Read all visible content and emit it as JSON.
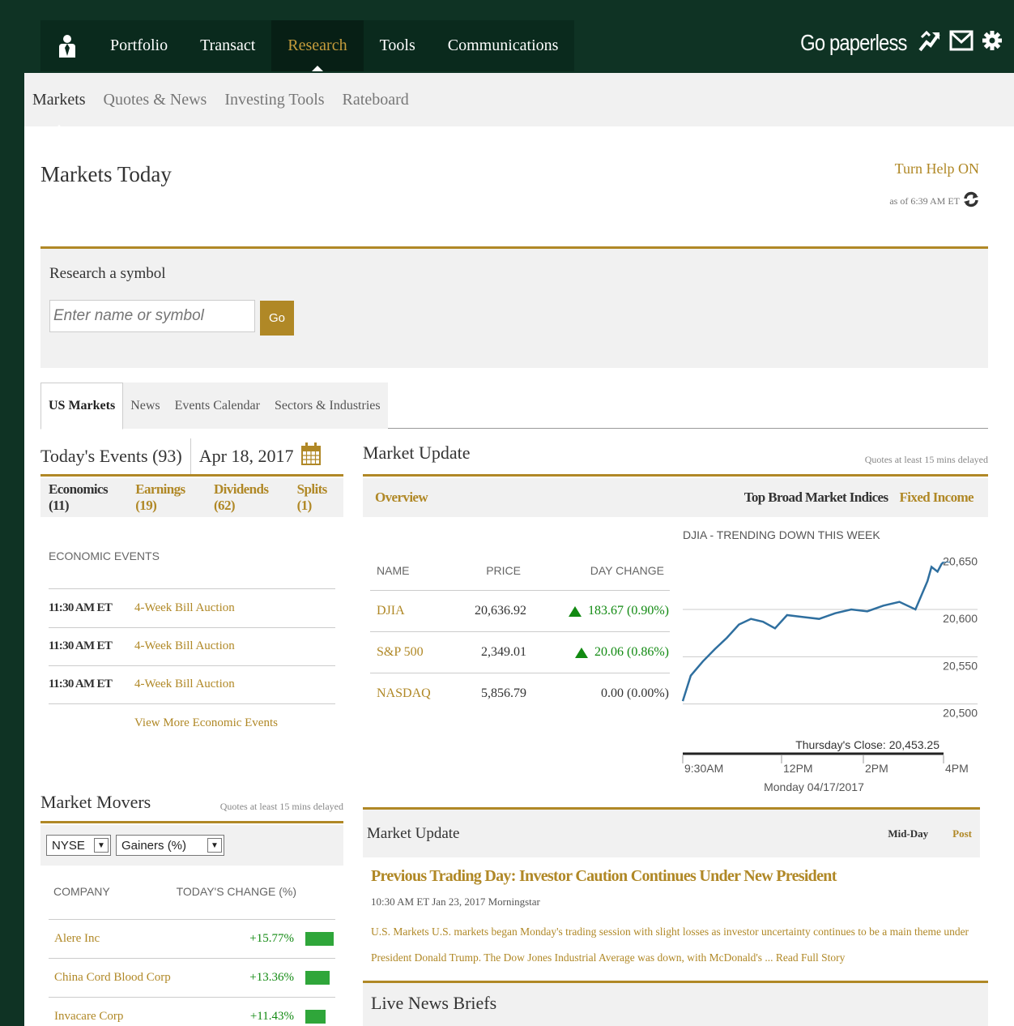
{
  "topnav": {
    "items": [
      "Portfolio",
      "Transact",
      "Research",
      "Tools",
      "Communications"
    ],
    "active": "Research",
    "go_paperless": "Go paperless",
    "icons": [
      "user-icon",
      "chart-arrow-icon",
      "mail-icon",
      "gear-icon"
    ]
  },
  "subnav": {
    "items": [
      "Markets",
      "Quotes & News",
      "Investing Tools",
      "Rateboard"
    ],
    "active": "Markets"
  },
  "page": {
    "title": "Markets Today",
    "help_link": "Turn Help ON",
    "as_of": "as of 6:39 AM ET"
  },
  "research": {
    "label": "Research a symbol",
    "placeholder": "Enter name or symbol",
    "go_label": "Go"
  },
  "tabs": [
    "US Markets",
    "News",
    "Events Calendar",
    "Sectors & Industries"
  ],
  "events": {
    "title": "Today's Events (93)",
    "date": "Apr 18, 2017",
    "filters": [
      "Economics (11)",
      "Earnings (19)",
      "Dividends (62)",
      "Splits (1)"
    ],
    "section_label": "ECONOMIC EVENTS",
    "rows": [
      {
        "time": "11:30 AM ET",
        "event": "4-Week Bill Auction"
      },
      {
        "time": "11:30 AM ET",
        "event": "4-Week Bill Auction"
      },
      {
        "time": "11:30 AM ET",
        "event": "4-Week Bill Auction"
      }
    ],
    "view_more": "View More Economic Events"
  },
  "movers": {
    "title": "Market Movers",
    "delay_note": "Quotes at least 15 mins delayed",
    "exchange": "NYSE",
    "type": "Gainers (%)",
    "col_company": "COMPANY",
    "col_change": "TODAY'S CHANGE (%)",
    "rows": [
      {
        "company": "Alere Inc",
        "change": "+15.77%",
        "pct": 15.77
      },
      {
        "company": "China Cord Blood Corp",
        "change": "+13.36%",
        "pct": 13.36
      },
      {
        "company": "Invacare Corp",
        "change": "+11.43%",
        "pct": 11.43
      }
    ]
  },
  "market_update": {
    "title": "Market Update",
    "delay_note": "Quotes at least 15 mins delayed",
    "overview": "Overview",
    "top_indices": "Top Broad Market Indices",
    "fixed_income": "Fixed Income",
    "col_name": "NAME",
    "col_price": "PRICE",
    "col_change": "DAY CHANGE",
    "rows": [
      {
        "name": "DJIA",
        "price": "20,636.92",
        "change": "183.67 (0.90%)",
        "up": true
      },
      {
        "name": "S&P 500",
        "price": "2,349.01",
        "change": "20.06 (0.86%)",
        "up": true
      },
      {
        "name": "NASDAQ",
        "price": "5,856.79",
        "change": "0.00 (0.00%)",
        "up": false
      }
    ]
  },
  "chart_data": {
    "type": "line",
    "title": "DJIA - TRENDING DOWN THIS WEEK",
    "x_ticks": [
      "9:30AM",
      "12PM",
      "2PM",
      "4PM"
    ],
    "y_ticks": [
      "20,650",
      "20,600",
      "20,550",
      "20,500"
    ],
    "ylim": [
      20480,
      20660
    ],
    "xlabel": "Monday 04/17/2017",
    "close_label": "Thursday's Close: 20,453.25",
    "series": [
      {
        "x": [
          0,
          0.2,
          0.5,
          0.8,
          1.1,
          1.4,
          1.7,
          2.0,
          2.3,
          2.6,
          3.0,
          3.4,
          3.8,
          4.2,
          4.6,
          5.0,
          5.4,
          5.8,
          6.0,
          6.1,
          6.2,
          6.35,
          6.45,
          6.5
        ],
        "y": [
          20503,
          20530,
          20545,
          20558,
          20570,
          20584,
          20590,
          20587,
          20580,
          20594,
          20592,
          20590,
          20596,
          20600,
          20598,
          20604,
          20608,
          20600,
          20620,
          20630,
          20645,
          20640,
          20648,
          20650
        ]
      }
    ]
  },
  "news_update": {
    "title": "Market Update",
    "mid_day": "Mid-Day",
    "post": "Post",
    "story_title": "Previous Trading Day: Investor Caution Continues Under New President",
    "story_meta": "10:30 AM ET  Jan 23, 2017  Morningstar",
    "story_body": "U.S. Markets U.S. markets began Monday's trading session with slight losses as investor uncertainty continues to be a main theme under President Donald Trump. The Dow Jones Industrial Average was down, with McDonald's ...",
    "read_more": "Read Full Story"
  },
  "live_news": {
    "title": "Live News Briefs"
  }
}
